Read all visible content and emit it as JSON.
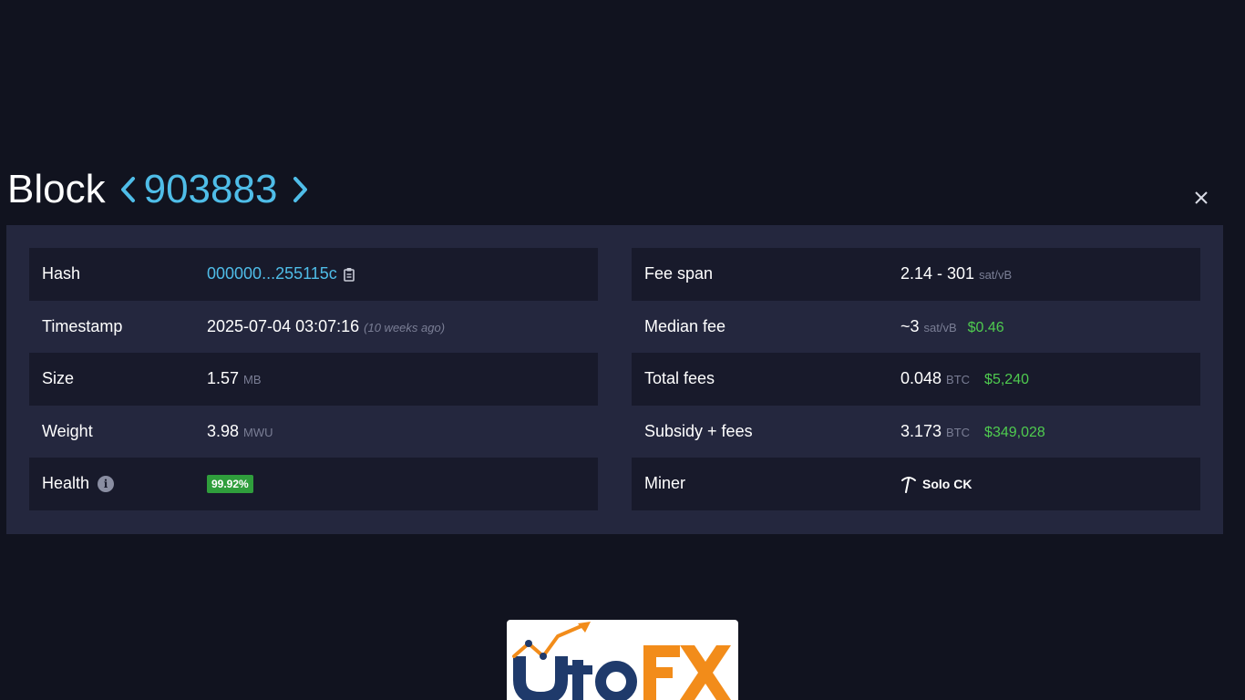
{
  "header": {
    "title_word": "Block",
    "block_number": "903883"
  },
  "left_rows": {
    "hash": {
      "label": "Hash",
      "value": "000000...255115c"
    },
    "timestamp": {
      "label": "Timestamp",
      "value": "2025-07-04 03:07:16",
      "relative": "(10 weeks ago)"
    },
    "size": {
      "label": "Size",
      "value": "1.57",
      "unit": "MB"
    },
    "weight": {
      "label": "Weight",
      "value": "3.98",
      "unit": "MWU"
    },
    "health": {
      "label": "Health",
      "info_glyph": "i",
      "value": "99.92%"
    }
  },
  "right_rows": {
    "fee_span": {
      "label": "Fee span",
      "value": "2.14 - 301",
      "unit": "sat/vB"
    },
    "median_fee": {
      "label": "Median fee",
      "value": "~3",
      "unit": "sat/vB",
      "usd": "$0.46"
    },
    "total_fees": {
      "label": "Total fees",
      "value": "0.048",
      "unit": "BTC",
      "usd": "$5,240"
    },
    "subsidy_fees": {
      "label": "Subsidy + fees",
      "value": "3.173",
      "unit": "BTC",
      "usd": "$349,028"
    },
    "miner": {
      "label": "Miner",
      "value": "Solo CK"
    }
  },
  "logo": {
    "text_part1": "Uto",
    "text_part2": "FX"
  },
  "colors": {
    "background": "#11131f",
    "panel": "#24273e",
    "row_dark": "#181a2b",
    "accent_blue": "#4fbde8",
    "usd_green": "#4fcb4f",
    "badge_green": "#2f9e3c",
    "muted": "#7a7e95"
  },
  "icons": [
    "chevron-left-icon",
    "chevron-right-icon",
    "close-icon",
    "copy-icon",
    "info-icon",
    "pickaxe-icon"
  ]
}
